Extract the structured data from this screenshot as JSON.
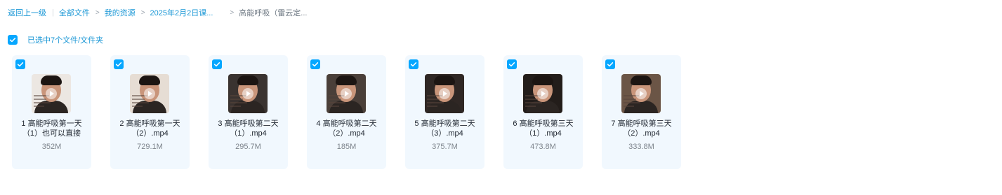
{
  "breadcrumb": {
    "back": "返回上一级",
    "items": [
      "全部文件",
      "我的资源",
      "2025年2月2日课...",
      "高能呼吸（雷云定..."
    ]
  },
  "selection": {
    "label": "已选中7个文件/文件夹",
    "checked": true
  },
  "files": [
    {
      "name": "1 高能呼吸第一天（1）也可以直接",
      "size": "352M",
      "checked": true,
      "icon": "video-thumbnail",
      "bg": "#ece7e2"
    },
    {
      "name": "2 高能呼吸第一天（2）.mp4",
      "size": "729.1M",
      "checked": true,
      "icon": "video-thumbnail",
      "bg": "#e6ddd4"
    },
    {
      "name": "3 高能呼吸第二天（1）.mp4",
      "size": "295.7M",
      "checked": true,
      "icon": "video-thumbnail",
      "bg": "#3a3330"
    },
    {
      "name": "4 高能呼吸第二天（2）.mp4",
      "size": "185M",
      "checked": true,
      "icon": "video-thumbnail",
      "bg": "#4a3f39"
    },
    {
      "name": "5 高能呼吸第二天（3）.mp4",
      "size": "375.7M",
      "checked": true,
      "icon": "video-thumbnail",
      "bg": "#2f2724"
    },
    {
      "name": "6 高能呼吸第三天（1）.mp4",
      "size": "473.8M",
      "checked": true,
      "icon": "video-thumbnail",
      "bg": "#231d1a"
    },
    {
      "name": "7 高能呼吸第三天（2）.mp4",
      "size": "333.8M",
      "checked": true,
      "icon": "video-thumbnail",
      "bg": "#6b5546"
    }
  ],
  "colors": {
    "accent": "#06a7ff",
    "link": "#1a97d6",
    "card_bg": "#f1f8fe"
  }
}
